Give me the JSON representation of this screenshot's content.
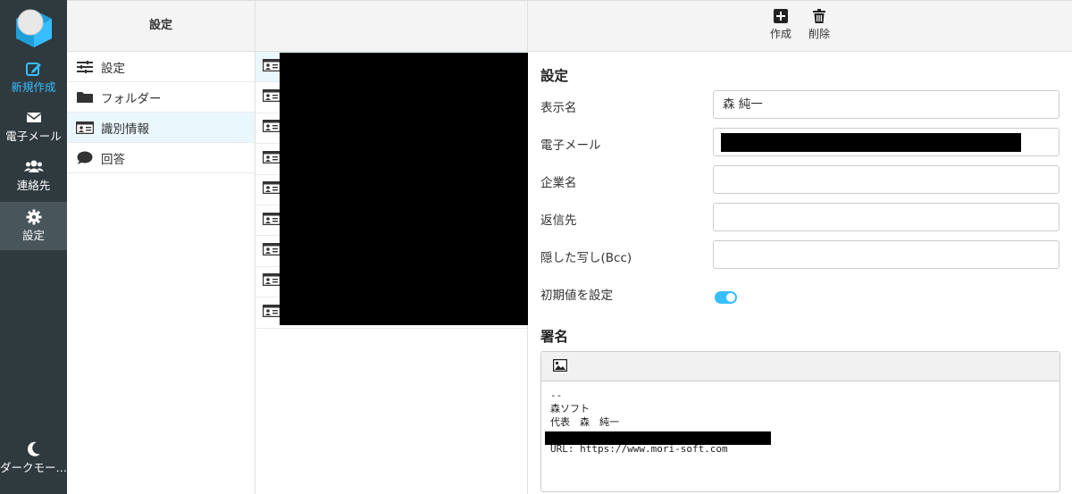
{
  "nav": {
    "items": [
      {
        "label": "新規作成",
        "icon": "edit-icon"
      },
      {
        "label": "電子メール",
        "icon": "envelope-icon"
      },
      {
        "label": "連絡先",
        "icon": "users-icon"
      },
      {
        "label": "設定",
        "icon": "gear-icon"
      },
      {
        "label": "ダークモー…",
        "icon": "moon-icon"
      }
    ]
  },
  "settings_column": {
    "title": "設定",
    "items": [
      {
        "label": "設定",
        "icon": "sliders-icon"
      },
      {
        "label": "フォルダー",
        "icon": "folder-icon"
      },
      {
        "label": "識別情報",
        "icon": "id-card-icon"
      },
      {
        "label": "回答",
        "icon": "speech-bubble-icon"
      }
    ]
  },
  "toolbar": {
    "create_label": "作成",
    "delete_label": "削除"
  },
  "form": {
    "section_title": "設定",
    "display_name_label": "表示名",
    "display_name_value": "森 純一",
    "email_label": "電子メール",
    "organization_label": "企業名",
    "reply_to_label": "返信先",
    "bcc_label": "隠した写し(Bcc)",
    "default_label": "初期値を設定",
    "signature_title": "署名",
    "signature_lines": [
      "--",
      "森ソフト",
      "代表　森　純一",
      "",
      "URL: https://www.mori-soft.com"
    ]
  },
  "colors": {
    "sidebar_bg": "#2f3a3f",
    "accent": "#37beff",
    "selected_row": "#eaf7fd"
  }
}
